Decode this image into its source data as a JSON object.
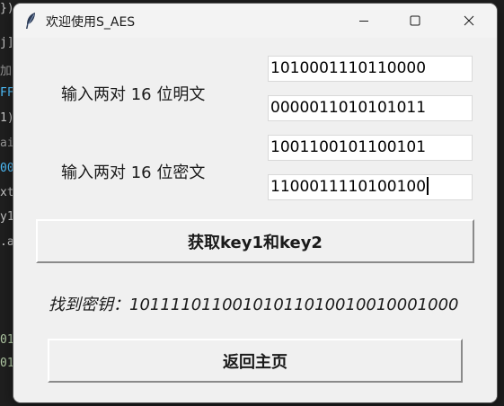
{
  "window": {
    "title": "欢迎使用S_AES",
    "icon": "feather-icon"
  },
  "form": {
    "plaintext_label": "输入两对 16 位明文",
    "ciphertext_label": "输入两对 16 位密文",
    "plaintext_1": "1010001110110000",
    "plaintext_2": "0000011010101011",
    "ciphertext_1": "1001100101100101",
    "ciphertext_2": "1100011110100100"
  },
  "actions": {
    "get_keys_label": "获取key1和key2",
    "back_label": "返回主页"
  },
  "result": {
    "text": "找到密钥：10111101100101011010010010001000"
  },
  "background_code": {
    "lines": [
      "j]",
      "加",
      "FF",
      "1)",
      "ai",
      "00",
      "xt",
      "y1",
      ".a",
      "01",
      "01"
    ]
  }
}
